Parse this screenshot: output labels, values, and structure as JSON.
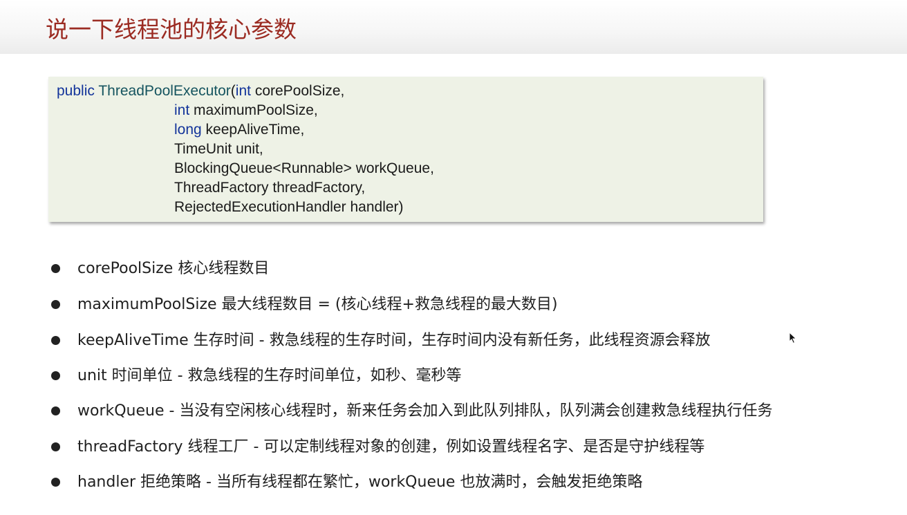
{
  "slide": {
    "title": "说一下线程池的核心参数"
  },
  "code": {
    "line1": {
      "kw_public": "public",
      "cls_name": "ThreadPoolExecutor",
      "paren_open": "(",
      "kw_int": "int",
      "param": " corePoolSize,"
    },
    "line2": {
      "kw": "int",
      "param": " maximumPoolSize,"
    },
    "line3": {
      "kw": "long",
      "param": " keepAliveTime,"
    },
    "line4": "TimeUnit unit,",
    "line5": "BlockingQueue<Runnable> workQueue,",
    "line6": "ThreadFactory threadFactory,",
    "line7": "RejectedExecutionHandler handler)"
  },
  "bullets": [
    "corePoolSize 核心线程数目",
    "maximumPoolSize 最大线程数目 = (核心线程+救急线程的最大数目)",
    "keepAliveTime 生存时间 - 救急线程的生存时间，生存时间内没有新任务，此线程资源会释放",
    "unit 时间单位 - 救急线程的生存时间单位，如秒、毫秒等",
    "workQueue - 当没有空闲核心线程时，新来任务会加入到此队列排队，队列满会创建救急线程执行任务",
    "threadFactory 线程工厂 - 可以定制线程对象的创建，例如设置线程名字、是否是守护线程等",
    "handler 拒绝策略 - 当所有线程都在繁忙，workQueue 也放满时，会触发拒绝策略"
  ],
  "colors": {
    "title": "#9b2b22",
    "keyword": "#13349a",
    "class_name": "#15545f",
    "code_bg": "#eef2e6"
  },
  "icons": {
    "cursor": "mouse-pointer-icon",
    "bullet": "filled-circle"
  }
}
